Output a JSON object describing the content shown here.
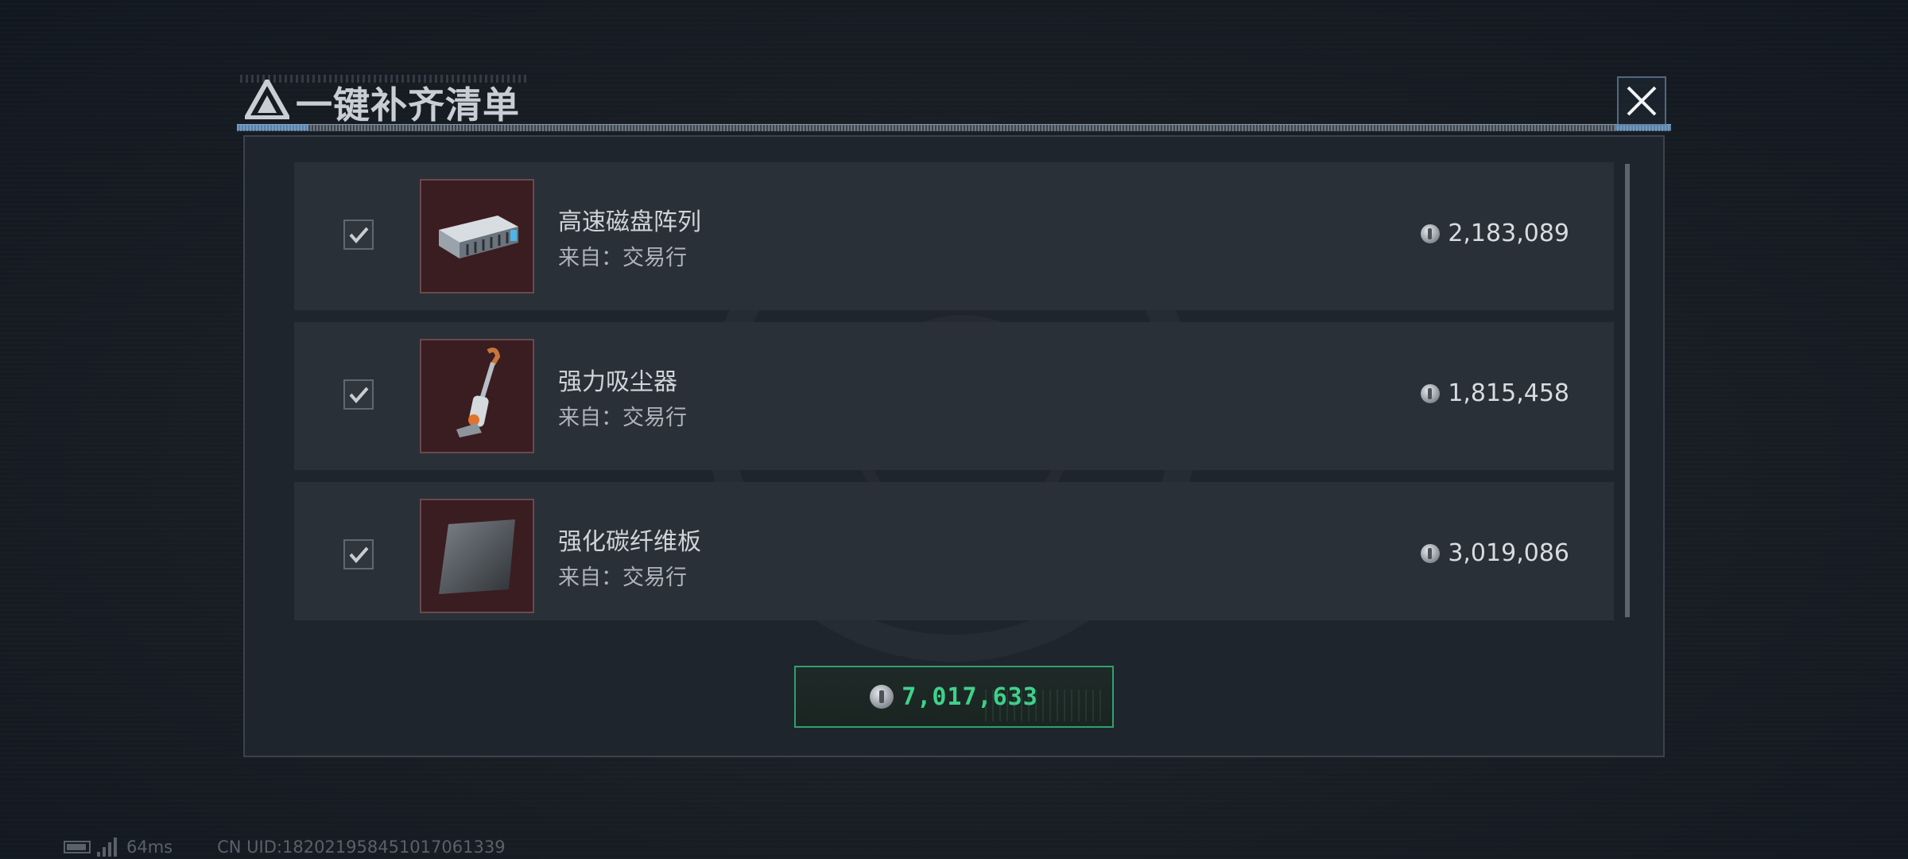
{
  "dialog": {
    "title": "一键补齐清单",
    "close_icon": "close-icon"
  },
  "items": [
    {
      "name": "高速磁盘阵列",
      "source": "来自：交易行",
      "price": "2,183,089",
      "checked": true,
      "icon": "disk-array-icon"
    },
    {
      "name": "强力吸尘器",
      "source": "来自：交易行",
      "price": "1,815,458",
      "checked": true,
      "icon": "vacuum-cleaner-icon"
    },
    {
      "name": "强化碳纤维板",
      "source": "来自：交易行",
      "price": "3,019,086",
      "checked": true,
      "icon": "carbon-fiber-plate-icon"
    }
  ],
  "total": {
    "value": "7,017,633",
    "icon": "coin-icon"
  },
  "status": {
    "ping": "64ms",
    "uid": "CN UID:18202195845101706133​9"
  },
  "colors": {
    "accent_green": "#3fd18a",
    "row_bg": "#2a3038",
    "thumb_bg": "#3a1d21"
  }
}
